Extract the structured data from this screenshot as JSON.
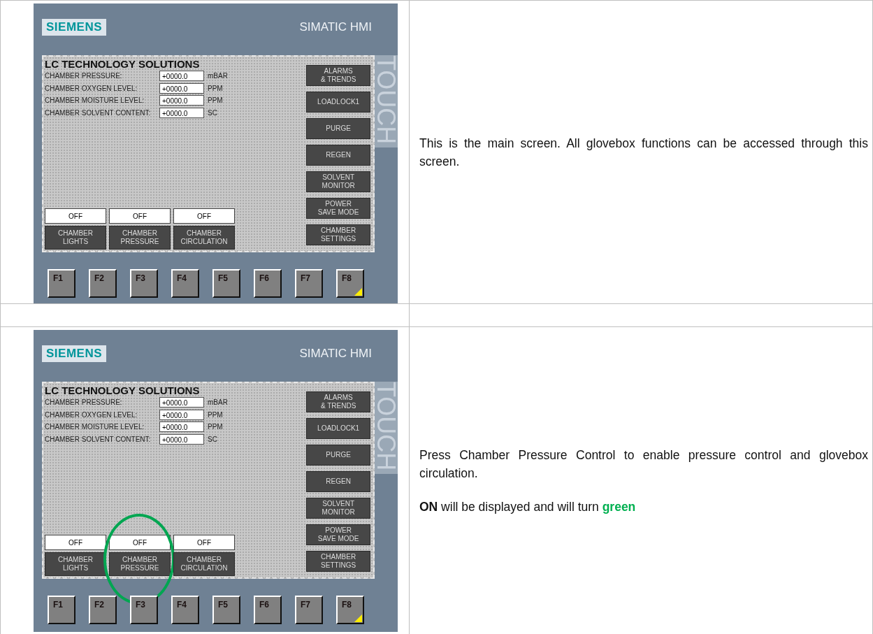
{
  "rows": [
    {
      "panel": {
        "brand": "SIEMENS",
        "model": "SIMATIC HMI",
        "side_label": "TOUCH",
        "title": "LC TECHNOLOGY SOLUTIONS",
        "readings": [
          {
            "label": "CHAMBER PRESSURE:",
            "value": "+0000.0",
            "unit": "mBAR"
          },
          {
            "label": "CHAMBER OXYGEN LEVEL:",
            "value": "+0000.0",
            "unit": "PPM"
          },
          {
            "label": "CHAMBER MOISTURE LEVEL:",
            "value": "+0000.0",
            "unit": "PPM"
          },
          {
            "label": "CHAMBER SOLVENT CONTENT:",
            "value": "+0000.0",
            "unit": "SC"
          }
        ],
        "menu_buttons": [
          "ALARMS\n& TRENDS",
          "LOADLOCK1",
          "PURGE",
          "REGEN",
          "SOLVENT\nMONITOR",
          "POWER\nSAVE MODE",
          "CHAMBER\nSETTINGS"
        ],
        "controls": [
          {
            "status": "OFF",
            "label": "CHAMBER\nLIGHTS",
            "circled": false
          },
          {
            "status": "OFF",
            "label": "CHAMBER\nPRESSURE",
            "circled": false
          },
          {
            "status": "OFF",
            "label": "CHAMBER\nCIRCULATION",
            "circled": false
          }
        ],
        "function_keys": [
          {
            "label": "F1",
            "corner_mark": false
          },
          {
            "label": "F2",
            "corner_mark": false
          },
          {
            "label": "F3",
            "corner_mark": false
          },
          {
            "label": "F4",
            "corner_mark": false
          },
          {
            "label": "F5",
            "corner_mark": false
          },
          {
            "label": "F6",
            "corner_mark": false
          },
          {
            "label": "F7",
            "corner_mark": false
          },
          {
            "label": "F8",
            "corner_mark": true
          }
        ]
      },
      "description": [
        [
          {
            "kind": "plain",
            "text": "This is the main screen. All glovebox functions can be accessed through this screen."
          }
        ]
      ]
    },
    {
      "panel": {
        "brand": "SIEMENS",
        "model": "SIMATIC HMI",
        "side_label": "TOUCH",
        "title": "LC TECHNOLOGY SOLUTIONS",
        "readings": [
          {
            "label": "CHAMBER PRESSURE:",
            "value": "+0000.0",
            "unit": "mBAR"
          },
          {
            "label": "CHAMBER OXYGEN LEVEL:",
            "value": "+0000.0",
            "unit": "PPM"
          },
          {
            "label": "CHAMBER MOISTURE LEVEL:",
            "value": "+0000.0",
            "unit": "PPM"
          },
          {
            "label": "CHAMBER SOLVENT CONTENT:",
            "value": "+0000.0",
            "unit": "SC"
          }
        ],
        "menu_buttons": [
          "ALARMS\n& TRENDS",
          "LOADLOCK1",
          "PURGE",
          "REGEN",
          "SOLVENT\nMONITOR",
          "POWER\nSAVE MODE",
          "CHAMBER\nSETTINGS"
        ],
        "controls": [
          {
            "status": "OFF",
            "label": "CHAMBER\nLIGHTS",
            "circled": false
          },
          {
            "status": "OFF",
            "label": "CHAMBER\nPRESSURE",
            "circled": true
          },
          {
            "status": "OFF",
            "label": "CHAMBER\nCIRCULATION",
            "circled": false
          }
        ],
        "function_keys": [
          {
            "label": "F1",
            "corner_mark": false
          },
          {
            "label": "F2",
            "corner_mark": false
          },
          {
            "label": "F3",
            "corner_mark": false
          },
          {
            "label": "F4",
            "corner_mark": false
          },
          {
            "label": "F5",
            "corner_mark": false
          },
          {
            "label": "F6",
            "corner_mark": false
          },
          {
            "label": "F7",
            "corner_mark": false
          },
          {
            "label": "F8",
            "corner_mark": true
          }
        ]
      },
      "description": [
        [
          {
            "kind": "plain",
            "text": "Press Chamber Pressure Control to enable pressure control and glovebox circulation."
          }
        ],
        [
          {
            "kind": "bold",
            "text": "ON"
          },
          {
            "kind": "plain",
            "text": " will be displayed and will turn "
          },
          {
            "kind": "green",
            "text": "green"
          }
        ]
      ]
    }
  ]
}
